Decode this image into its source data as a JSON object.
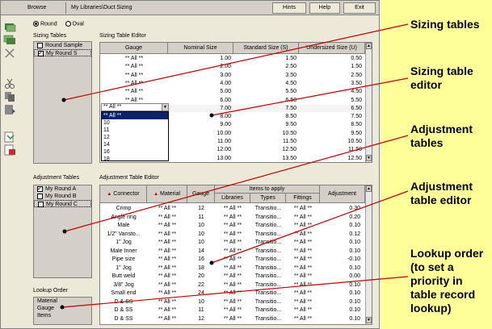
{
  "menubar": {
    "browse": "Browse",
    "path": "My Libraries\\Duct Sizing",
    "hints": "Hints",
    "help": "Help",
    "exit": "Exit"
  },
  "shape": {
    "round": "Round",
    "oval": "Oval",
    "selected": "Round"
  },
  "sizing_tables": {
    "title": "Sizing Tables",
    "items": [
      {
        "label": "Round Sample",
        "checked": false
      },
      {
        "label": "My Round S",
        "checked": true
      }
    ]
  },
  "sizing_editor": {
    "title": "Sizing Table Editor",
    "columns": [
      "Gauge",
      "Nominal Size",
      "Standard Size (S)",
      "Undersized Size (U)"
    ],
    "rows": [
      [
        "** All **",
        "1.00",
        "1.50",
        "0.50"
      ],
      [
        "** All **",
        "2.00",
        "2.50",
        "1.50"
      ],
      [
        "** All **",
        "3.00",
        "3.50",
        "2.50"
      ],
      [
        "** All **",
        "4.00",
        "4.50",
        "3.50"
      ],
      [
        "** All **",
        "5.00",
        "5.50",
        "4.50"
      ],
      [
        "** All **",
        "6.00",
        "6.50",
        "5.50"
      ],
      [
        "** All **",
        "7.00",
        "7.50",
        "6.50"
      ],
      [
        "",
        "8.00",
        "8.50",
        "7.50"
      ],
      [
        "",
        "9.00",
        "9.50",
        "8.50"
      ],
      [
        "",
        "10.00",
        "10.50",
        "9.50"
      ],
      [
        "",
        "11.00",
        "11.50",
        "10.50"
      ],
      [
        "",
        "12.00",
        "12.50",
        "11.50"
      ],
      [
        "",
        "13.00",
        "13.50",
        "12.50"
      ]
    ],
    "combo_value": "** All **",
    "dropdown": [
      "** All **",
      "10",
      "11",
      "12",
      "14",
      "16",
      "18"
    ]
  },
  "adjustment_tables": {
    "title": "Adjustment Tables",
    "items": [
      {
        "label": "My Round A",
        "checked": true
      },
      {
        "label": "My Round B",
        "checked": false
      },
      {
        "label": "My Round C",
        "checked": false
      }
    ]
  },
  "adjustment_editor": {
    "title": "Adjustment Table Editor",
    "group_header": "Items to apply",
    "columns": [
      "Connector",
      "Material",
      "Gauge",
      "Libraries",
      "Types",
      "Fittings",
      "Adjustment"
    ],
    "rows": [
      [
        "Crimp",
        "** All **",
        "12",
        "** All **",
        "Transitio...",
        "** All **",
        "0.30"
      ],
      [
        "Angle ring",
        "** All **",
        "11",
        "** All **",
        "Transitio...",
        "** All **",
        "0.20"
      ],
      [
        "Male",
        "** All **",
        "10",
        "** All **",
        "Transitio...",
        "** All **",
        "0.10"
      ],
      [
        "1/2\" Vansto...",
        "** All **",
        "10",
        "** All **",
        "Transitio...",
        "** All **",
        "0.12"
      ],
      [
        "1\" Jog",
        "** All **",
        "10",
        "** All **",
        "Transitio...",
        "** All **",
        "0.10"
      ],
      [
        "Male Inner",
        "** All **",
        "14",
        "** All **",
        "Transitio...",
        "** All **",
        "0.10"
      ],
      [
        "Pipe size",
        "** All **",
        "16",
        "** All **",
        "Transitio...",
        "** All **",
        "-0.10"
      ],
      [
        "1\" Jog",
        "** All **",
        "18",
        "** All **",
        "Transitio...",
        "** All **",
        "0.10"
      ],
      [
        "Butt weld",
        "** All **",
        "20",
        "** All **",
        "Transitio...",
        "** All **",
        "0.00"
      ],
      [
        "3/8\" Jog",
        "** All **",
        "22",
        "** All **",
        "Transitio...",
        "** All **",
        "0.10"
      ],
      [
        "Small end",
        "** All **",
        "24",
        "** All **",
        "Transitio...",
        "** All **",
        "0.10"
      ],
      [
        "D & SS",
        "** All **",
        "10",
        "** All **",
        "Transitio...",
        "** All **",
        "0.10"
      ],
      [
        "D & SS",
        "** All **",
        "11",
        "** All **",
        "Transitio...",
        "** All **",
        "0.10"
      ],
      [
        "D & SS",
        "** All **",
        "12",
        "** All **",
        "Transitio...",
        "** All **",
        "0.10"
      ]
    ]
  },
  "lookup_order": {
    "title": "Lookup Order",
    "items": [
      "Material",
      "Gauge",
      "Items"
    ]
  },
  "callouts": {
    "sizing_tables": "Sizing tables",
    "sizing_table_editor": "Sizing table editor",
    "adjustment_tables": "Adjustment tables",
    "adjustment_table_editor": "Adjustment table editor",
    "lookup_order": "Lookup order (to set a priority in table record lookup)"
  },
  "colors": {
    "callout_bg": "#ffff99",
    "window_bg": "#ece9d8",
    "selection": "#0a246a",
    "sort_arrow": "#c00000"
  }
}
